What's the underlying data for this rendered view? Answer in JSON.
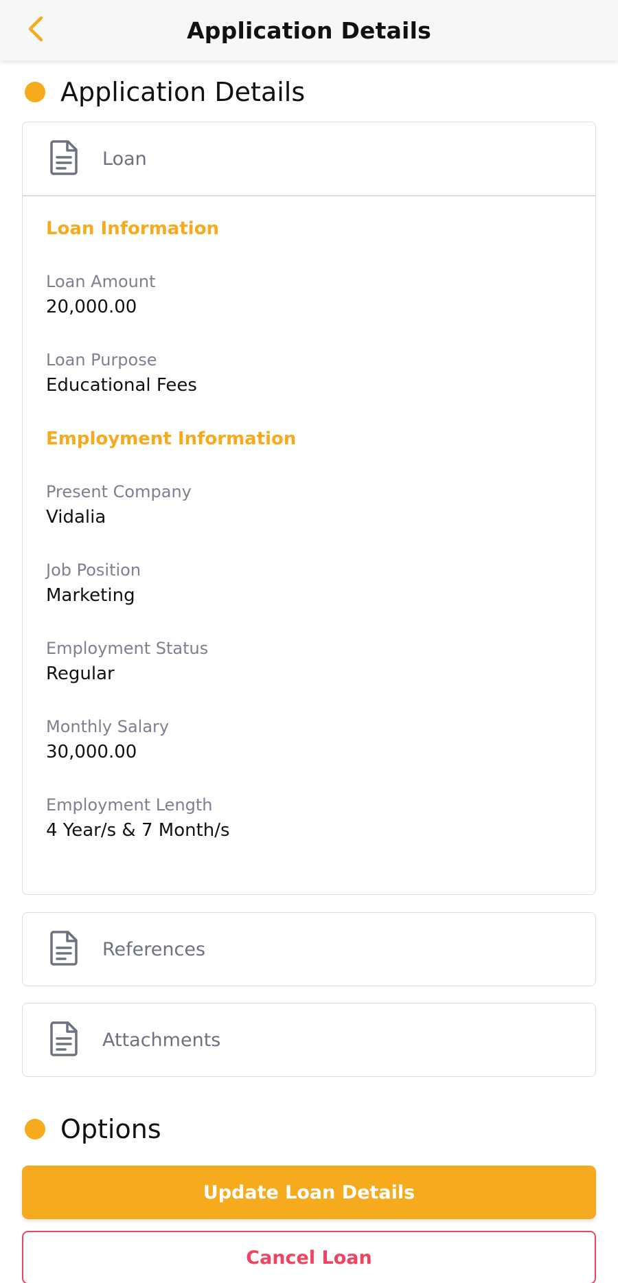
{
  "header": {
    "title": "Application Details",
    "back_icon": "chevron-left-icon"
  },
  "section_application": {
    "title": "Application Details"
  },
  "loan_card": {
    "header_label": "Loan",
    "icon": "document-icon",
    "loan_information": {
      "title": "Loan Information",
      "fields": [
        {
          "label": "Loan Amount",
          "value": "20,000.00"
        },
        {
          "label": "Loan Purpose",
          "value": "Educational Fees"
        }
      ]
    },
    "employment_information": {
      "title": "Employment Information",
      "fields": [
        {
          "label": "Present Company",
          "value": "Vidalia"
        },
        {
          "label": "Job Position",
          "value": "Marketing"
        },
        {
          "label": "Employment Status",
          "value": "Regular"
        },
        {
          "label": "Monthly Salary",
          "value": "30,000.00"
        },
        {
          "label": "Employment Length",
          "value": "4 Year/s & 7 Month/s"
        }
      ]
    }
  },
  "references_card": {
    "header_label": "References",
    "icon": "document-icon"
  },
  "attachments_card": {
    "header_label": "Attachments",
    "icon": "document-icon"
  },
  "section_options": {
    "title": "Options"
  },
  "buttons": {
    "update_label": "Update Loan Details",
    "cancel_label": "Cancel Loan"
  },
  "colors": {
    "accent": "#f6ab1f",
    "danger": "#ef4360",
    "muted_text": "#7d8090",
    "border": "#dedede"
  }
}
